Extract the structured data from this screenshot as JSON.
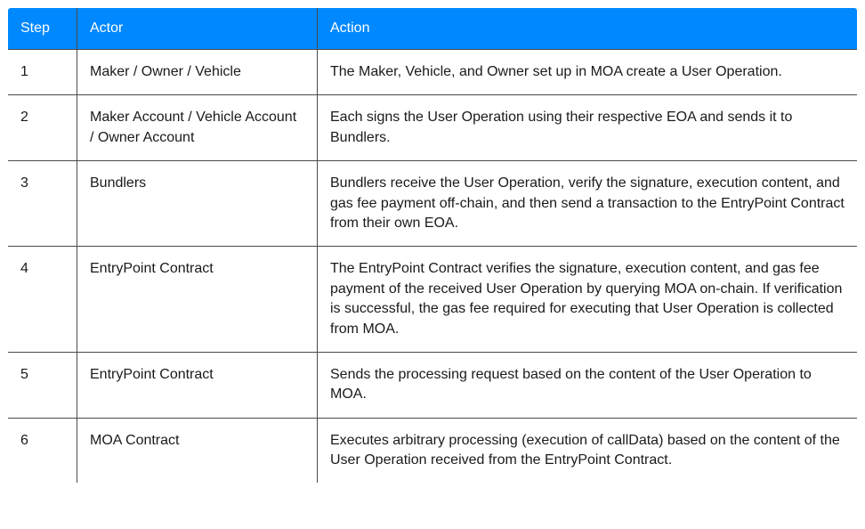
{
  "chart_data": {
    "type": "table",
    "headers": [
      "Step",
      "Actor",
      "Action"
    ],
    "rows": [
      {
        "step": "1",
        "actor": "Maker / Owner / Vehicle",
        "action": "The Maker, Vehicle, and Owner set up in MOA create a User Operation."
      },
      {
        "step": "2",
        "actor": "Maker Account / Vehicle Account / Owner Account",
        "action": "Each signs the User Operation using their respective EOA and sends it to Bundlers."
      },
      {
        "step": "3",
        "actor": "Bundlers",
        "action": "Bundlers receive the User Operation, verify the signature, execution content, and gas fee payment off-chain, and then send a transaction to the EntryPoint Contract from their own EOA."
      },
      {
        "step": "4",
        "actor": "EntryPoint Contract",
        "action": "The EntryPoint Contract verifies the signature, execution content, and gas fee payment of the received User Operation by querying MOA on-chain. If verification is successful, the gas fee required for executing that User Operation is collected from MOA."
      },
      {
        "step": "5",
        "actor": "EntryPoint Contract",
        "action": "Sends the processing request based on the content of the User Operation to MOA."
      },
      {
        "step": "6",
        "actor": "MOA Contract",
        "action": "Executes arbitrary processing (execution of callData) based on the content of the User Operation received from the EntryPoint Contract."
      }
    ]
  }
}
